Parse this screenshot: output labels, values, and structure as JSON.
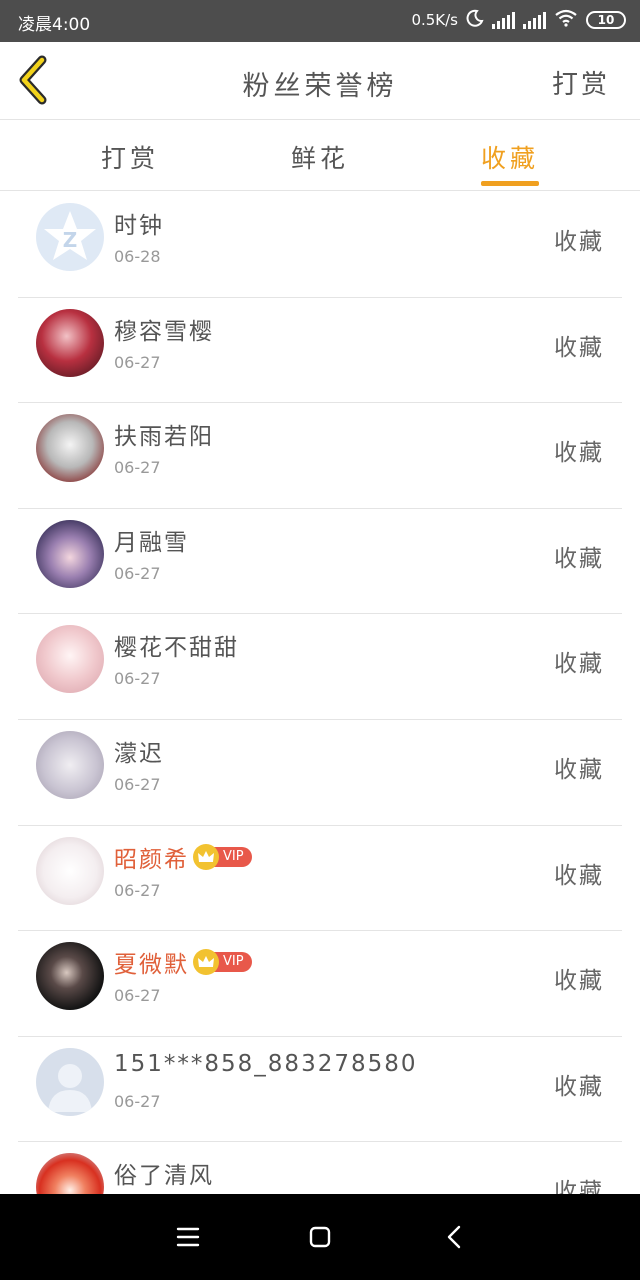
{
  "status": {
    "time": "凌晨4:00",
    "speed": "0.5K/s",
    "battery": "10"
  },
  "header": {
    "title": "粉丝荣誉榜",
    "action": "打赏"
  },
  "tabs": [
    {
      "label": "打赏",
      "active": false
    },
    {
      "label": "鲜花",
      "active": false
    },
    {
      "label": "收藏",
      "active": true
    }
  ],
  "colors": {
    "accent": "#f0a020",
    "vip_name": "#e0603a",
    "vip_tag": "#e8584a"
  },
  "list": [
    {
      "name": "时钟",
      "date": "06-28",
      "action": "收藏",
      "vip": false
    },
    {
      "name": "穆容雪樱",
      "date": "06-27",
      "action": "收藏",
      "vip": false
    },
    {
      "name": "扶雨若阳",
      "date": "06-27",
      "action": "收藏",
      "vip": false
    },
    {
      "name": "月融雪",
      "date": "06-27",
      "action": "收藏",
      "vip": false
    },
    {
      "name": "樱花不甜甜",
      "date": "06-27",
      "action": "收藏",
      "vip": false
    },
    {
      "name": "濛迟",
      "date": "06-27",
      "action": "收藏",
      "vip": false
    },
    {
      "name": "昭颜希",
      "date": "06-27",
      "action": "收藏",
      "vip": true,
      "vip_label": "VIP"
    },
    {
      "name": "夏微默",
      "date": "06-27",
      "action": "收藏",
      "vip": true,
      "vip_label": "VIP"
    },
    {
      "name": "151***858_883278580",
      "date": "06-27",
      "action": "收藏",
      "vip": false
    },
    {
      "name": "俗了清风",
      "date": "",
      "action": "收藏",
      "vip": false
    }
  ]
}
